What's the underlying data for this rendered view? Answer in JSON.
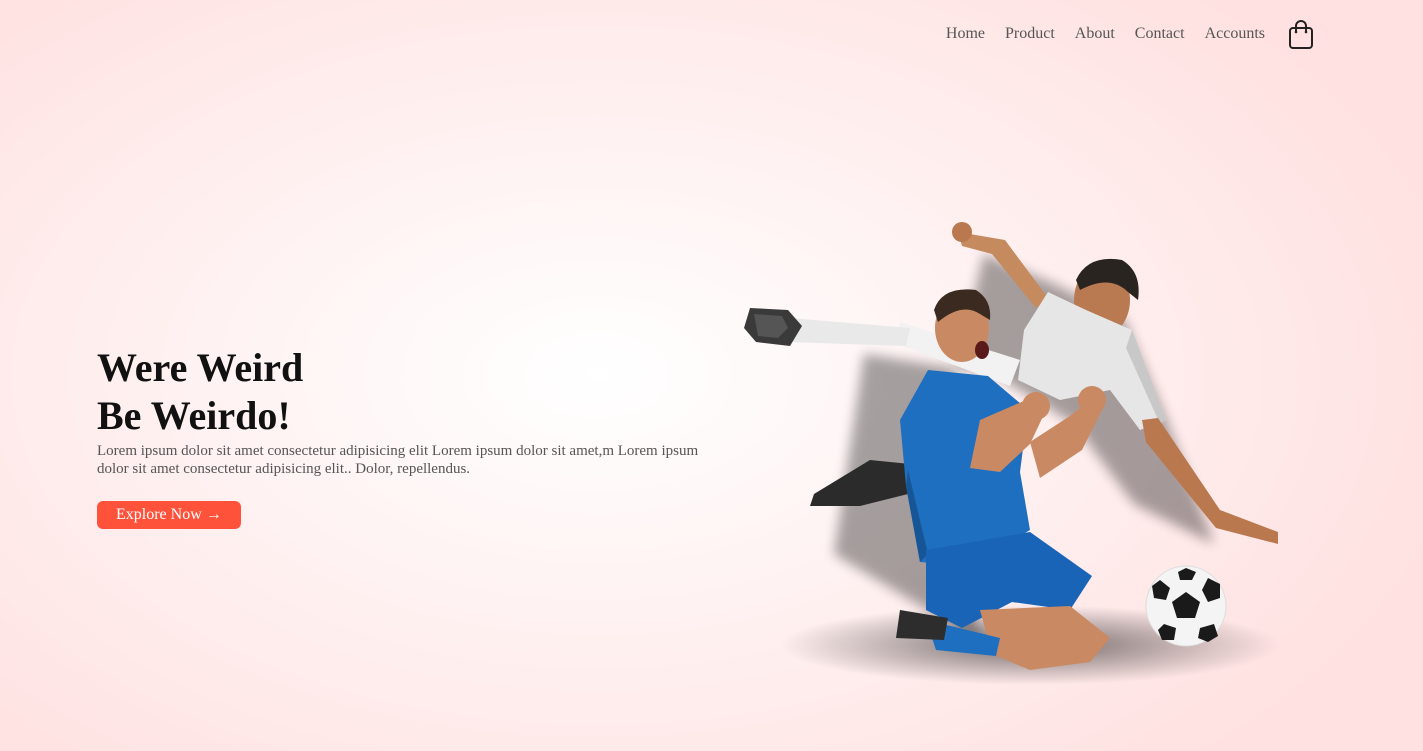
{
  "nav": {
    "items": [
      {
        "label": "Home"
      },
      {
        "label": "Product"
      },
      {
        "label": "About"
      },
      {
        "label": "Contact"
      },
      {
        "label": "Accounts"
      }
    ],
    "cart_icon": "shopping-bag-icon"
  },
  "hero": {
    "headline_line1": "Were Weird",
    "headline_line2": "Be Weirdo!",
    "description": "Lorem ipsum dolor sit amet consectetur adipisicing elit Lorem ipsum dolor sit amet,m Lorem ipsum dolor sit amet consectetur adipisicing elit.. Dolor, repellendus.",
    "button_label": "Explore Now →"
  },
  "colors": {
    "accent": "#ff523b",
    "background_center": "#ffffff",
    "background_edge": "#ffe1e1",
    "text_dark": "#111111",
    "text_muted": "#555555"
  }
}
